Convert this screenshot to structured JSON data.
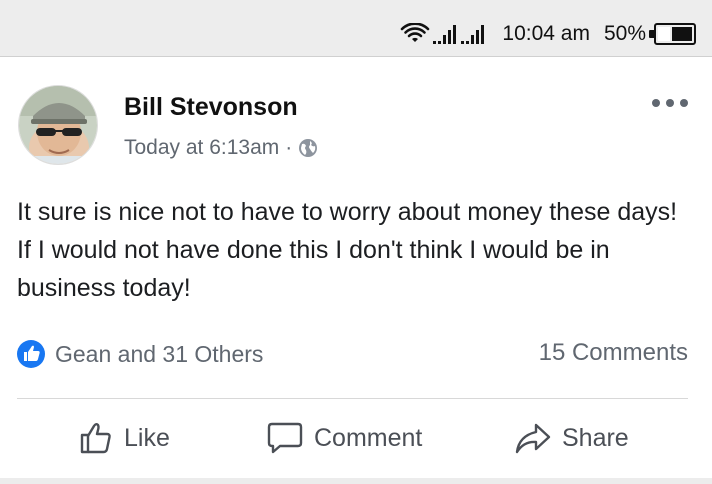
{
  "status_bar": {
    "time": "10:04 am",
    "battery_percent": "50%",
    "battery_level": 0.3
  },
  "post": {
    "author": "Bill Stevonson",
    "timestamp": "Today at 6:13am",
    "separator": "·",
    "privacy_icon": "globe-icon",
    "body": "It sure is nice not to have to worry about money these days! If I would not have done this I don't think I would be in business today!",
    "reactions_text": "Gean and 31 Others",
    "comments_count": "15 Comments"
  },
  "actions": {
    "like_label": "Like",
    "comment_label": "Comment",
    "share_label": "Share"
  },
  "colors": {
    "accent_blue": "#1877f2",
    "text_secondary": "#606770",
    "status_bar_bg": "#ededed"
  }
}
